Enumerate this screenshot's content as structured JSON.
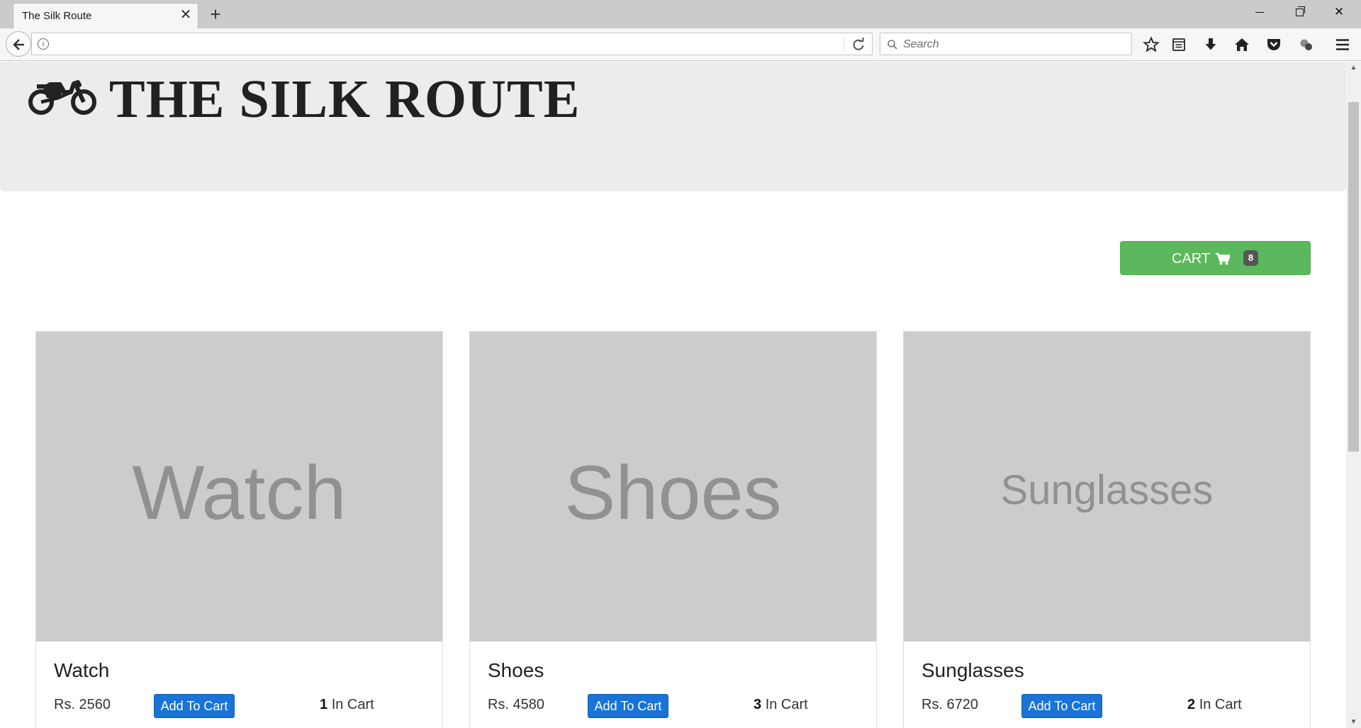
{
  "browser": {
    "tab_title": "The Silk Route",
    "tab_close_glyph": "✕",
    "new_tab_glyph": "+",
    "search_placeholder": "Search",
    "url_info_glyph": "i",
    "window_close_glyph": "✕",
    "scroll_up_glyph": "▲",
    "scroll_down_glyph": "▼"
  },
  "site": {
    "title": "THE SILK ROUTE",
    "logo_icon": "motorcycle-icon"
  },
  "cart": {
    "label": "CART",
    "icon": "shopping-cart-icon",
    "count": "8",
    "color": "#5cb85c"
  },
  "products": [
    {
      "name": "Watch",
      "image_text": "Watch",
      "price": "Rs. 2560",
      "button": "Add To Cart",
      "qty": "1",
      "qty_suffix": "In Cart"
    },
    {
      "name": "Shoes",
      "image_text": "Shoes",
      "price": "Rs. 4580",
      "button": "Add To Cart",
      "qty": "3",
      "qty_suffix": "In Cart"
    },
    {
      "name": "Sunglasses",
      "image_text": "Sunglasses",
      "price": "Rs. 6720",
      "button": "Add To Cart",
      "qty": "2",
      "qty_suffix": "In Cart"
    }
  ],
  "colors": {
    "add_button": "#1a73d6",
    "jumbotron": "#ebecee",
    "placeholder_image": "#cccccc"
  }
}
